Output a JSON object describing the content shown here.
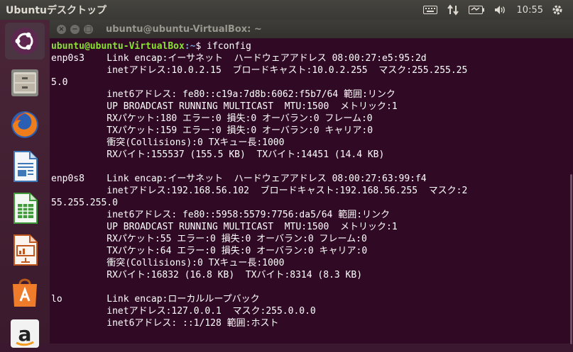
{
  "top_panel": {
    "title": "Ubuntuデスクトップ",
    "clock": "10:55"
  },
  "launcher": {
    "items": [
      {
        "name": "Ubuntu Dash",
        "icon": "ubuntu-logo-icon"
      },
      {
        "name": "Files",
        "icon": "file-cabinet-icon"
      },
      {
        "name": "Firefox",
        "icon": "firefox-icon"
      },
      {
        "name": "LibreOffice Writer",
        "icon": "writer-icon"
      },
      {
        "name": "LibreOffice Calc",
        "icon": "calc-icon"
      },
      {
        "name": "LibreOffice Impress",
        "icon": "impress-icon"
      },
      {
        "name": "Ubuntu Software",
        "icon": "software-bag-icon"
      },
      {
        "name": "Amazon",
        "icon": "amazon-icon"
      }
    ]
  },
  "terminal": {
    "title": "ubuntu@ubuntu-VirtualBox: ~",
    "prompt_user": "ubuntu@ubuntu-VirtualBox",
    "prompt_path": ":~",
    "prompt_symbol": "$ ",
    "command": "ifconfig",
    "output": "enp0s3    Link encap:イーサネット  ハードウェアアドレス 08:00:27:e5:95:2d  \n          inetアドレス:10.0.2.15  ブロードキャスト:10.0.2.255  マスク:255.255.25\n5.0\n          inet6アドレス: fe80::c19a:7d8b:6062:f5b7/64 範囲:リンク\n          UP BROADCAST RUNNING MULTICAST  MTU:1500  メトリック:1\n          RXパケット:180 エラー:0 損失:0 オーバラン:0 フレーム:0\n          TXパケット:159 エラー:0 損失:0 オーバラン:0 キャリア:0\n          衝突(Collisions):0 TXキュー長:1000 \n          RXバイト:155537 (155.5 KB)  TXバイト:14451 (14.4 KB)\n\nenp0s8    Link encap:イーサネット  ハードウェアアドレス 08:00:27:63:99:f4  \n          inetアドレス:192.168.56.102  ブロードキャスト:192.168.56.255  マスク:2\n55.255.255.0\n          inet6アドレス: fe80::5958:5579:7756:da5/64 範囲:リンク\n          UP BROADCAST RUNNING MULTICAST  MTU:1500  メトリック:1\n          RXパケット:55 エラー:0 損失:0 オーバラン:0 フレーム:0\n          TXパケット:64 エラー:0 損失:0 オーバラン:0 キャリア:0\n          衝突(Collisions):0 TXキュー長:1000 \n          RXバイト:16832 (16.8 KB)  TXバイト:8314 (8.3 KB)\n\nlo        Link encap:ローカルループバック  \n          inetアドレス:127.0.0.1  マスク:255.0.0.0\n          inet6アドレス: ::1/128 範囲:ホスト"
  },
  "colors": {
    "terminal_bg": "#300a24",
    "prompt_user": "#8ae234",
    "prompt_path": "#729fcf"
  }
}
